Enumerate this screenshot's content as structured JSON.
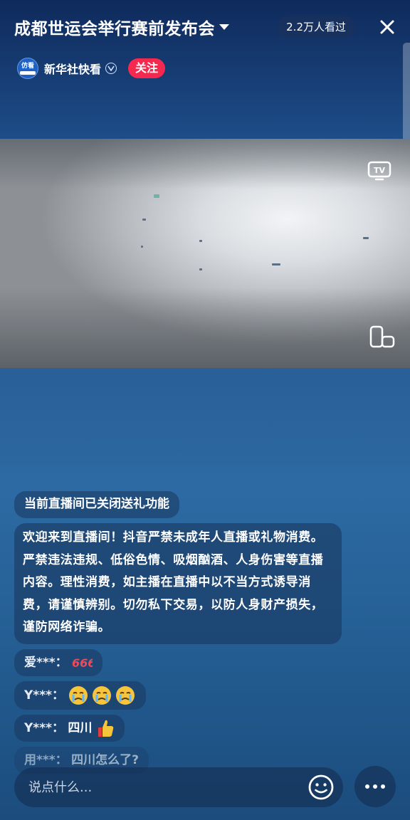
{
  "header": {
    "title": "成都世运会举行赛前发布会",
    "viewer_count": "2.2万人看过"
  },
  "author": {
    "avatar_text": "仿看",
    "name": "新华社快看",
    "follow_label": "关注"
  },
  "chat": {
    "system_notice": "当前直播间已关闭送礼功能",
    "welcome_notice": "欢迎来到直播间！抖音严禁未成年人直播或礼物消费。严禁违法违规、低俗色情、吸烟酗酒、人身伤害等直播内容。理性消费，如主播在直播中以不当方式诱导消费，请谨慎辨别。切勿私下交易，以防人身财产损失，谨防网络诈骗。",
    "messages": [
      {
        "user": "爱***：",
        "text": "",
        "emoji": "666-icon"
      },
      {
        "user": "Y***：",
        "text": "",
        "emoji": "crying-face-x3"
      },
      {
        "user": "Y***：",
        "text": "四川",
        "emoji": "thumbs-up-icon"
      },
      {
        "user": "用***：",
        "text": "四川怎么了?",
        "emoji": ""
      }
    ]
  },
  "input": {
    "placeholder": "说点什么..."
  },
  "icons": {
    "close": "close-icon",
    "tv": "tv-cast-icon",
    "rotate": "rotate-screen-icon",
    "emoji": "emoji-icon",
    "more": "more-icon"
  },
  "colors": {
    "follow": "#f5294f",
    "background_top": "#0f2a5c",
    "background_mid": "#2d6aa3"
  }
}
